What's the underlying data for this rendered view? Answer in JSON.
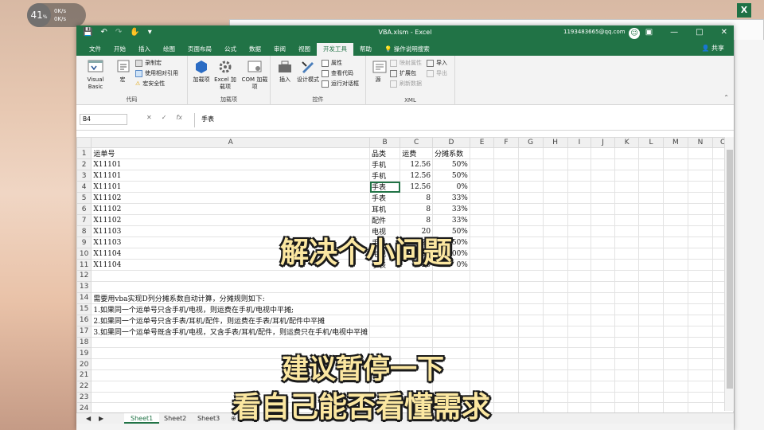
{
  "desktop": {
    "gauge_value": "41",
    "gauge_unit": "%",
    "gauge_line1": "0K/s",
    "gauge_line2": "0K/s",
    "excel_icon": "X"
  },
  "window": {
    "title": "VBA.xlsm  -  Excel",
    "account": "1193483665@qq.com",
    "share": "共享",
    "tabs": [
      "文件",
      "开始",
      "插入",
      "绘图",
      "页面布局",
      "公式",
      "数据",
      "审阅",
      "视图",
      "开发工具",
      "帮助",
      "操作说明搜索"
    ],
    "active_tab": "开发工具"
  },
  "ribbon": {
    "code_group": "代码",
    "visual_basic": "Visual Basic",
    "macros": "宏",
    "record_macro": "录制宏",
    "relative_ref": "使用相对引用",
    "macro_security": "宏安全性",
    "addins_group": "加载项",
    "addins": "加载项",
    "excel_addins": "Excel 加载项",
    "com_addins": "COM 加载项",
    "controls_group": "控件",
    "insert": "插入",
    "design_mode": "设计模式",
    "properties": "属性",
    "view_code": "查看代码",
    "run_dialog": "运行对话框",
    "xml_group": "XML",
    "source": "源",
    "map_props": "映射属性",
    "expansion_packs": "扩展包",
    "refresh_data": "刷新数据",
    "import": "导入",
    "export": "导出"
  },
  "formula_bar": {
    "name_box": "B4",
    "formula": "手表"
  },
  "columns": [
    "A",
    "B",
    "C",
    "D",
    "E",
    "F",
    "G",
    "H",
    "I",
    "J",
    "K",
    "L",
    "M",
    "N",
    "O"
  ],
  "rows": [
    [
      "运单号",
      "品类",
      "运费",
      "分摊系数"
    ],
    [
      "X11101",
      "手机",
      "12.56",
      "50%"
    ],
    [
      "X11101",
      "手机",
      "12.56",
      "50%"
    ],
    [
      "X11101",
      "手表",
      "12.56",
      "0%"
    ],
    [
      "X11102",
      "手表",
      "8",
      "33%"
    ],
    [
      "X11102",
      "耳机",
      "8",
      "33%"
    ],
    [
      "X11102",
      "配件",
      "8",
      "33%"
    ],
    [
      "X11103",
      "电视",
      "20",
      "50%"
    ],
    [
      "X11103",
      "手机",
      "20",
      "50%"
    ],
    [
      "X11104",
      "电视",
      "20",
      "100%"
    ],
    [
      "X11104",
      "手表",
      "20",
      "0%"
    ],
    [
      "",
      "",
      "",
      ""
    ],
    [
      "",
      "",
      "",
      ""
    ],
    [
      "需要用vba实现D列分摊系数自动计算，分摊规则如下:",
      "",
      "",
      ""
    ],
    [
      "1.如果同一个运单号只含手机/电视，则运费在手机/电视中平摊;",
      "",
      "",
      ""
    ],
    [
      "2.如果同一个运单号只含手表/耳机/配件，则运费在手表/耳机/配件中平摊",
      "",
      "",
      ""
    ],
    [
      "3.如果同一个运单号既含手机/电视，又含手表/耳机/配件，则运费只在手机/电视中平摊",
      "",
      "",
      ""
    ],
    [
      "",
      "",
      "",
      ""
    ],
    [
      "",
      "",
      "",
      ""
    ],
    [
      "",
      "",
      "",
      ""
    ],
    [
      "",
      "",
      "",
      ""
    ],
    [
      "",
      "",
      "",
      ""
    ],
    [
      "",
      "",
      "",
      ""
    ],
    [
      "",
      "",
      "",
      ""
    ]
  ],
  "sheets": [
    "Sheet1",
    "Sheet2",
    "Sheet3"
  ],
  "captions": {
    "line1": "解决个小问题",
    "line2": "建议暂停一下",
    "line3": "看自己能否看懂需求"
  },
  "colors": {
    "excel_green": "#217346",
    "caption_fill": "#fbe7a1"
  }
}
